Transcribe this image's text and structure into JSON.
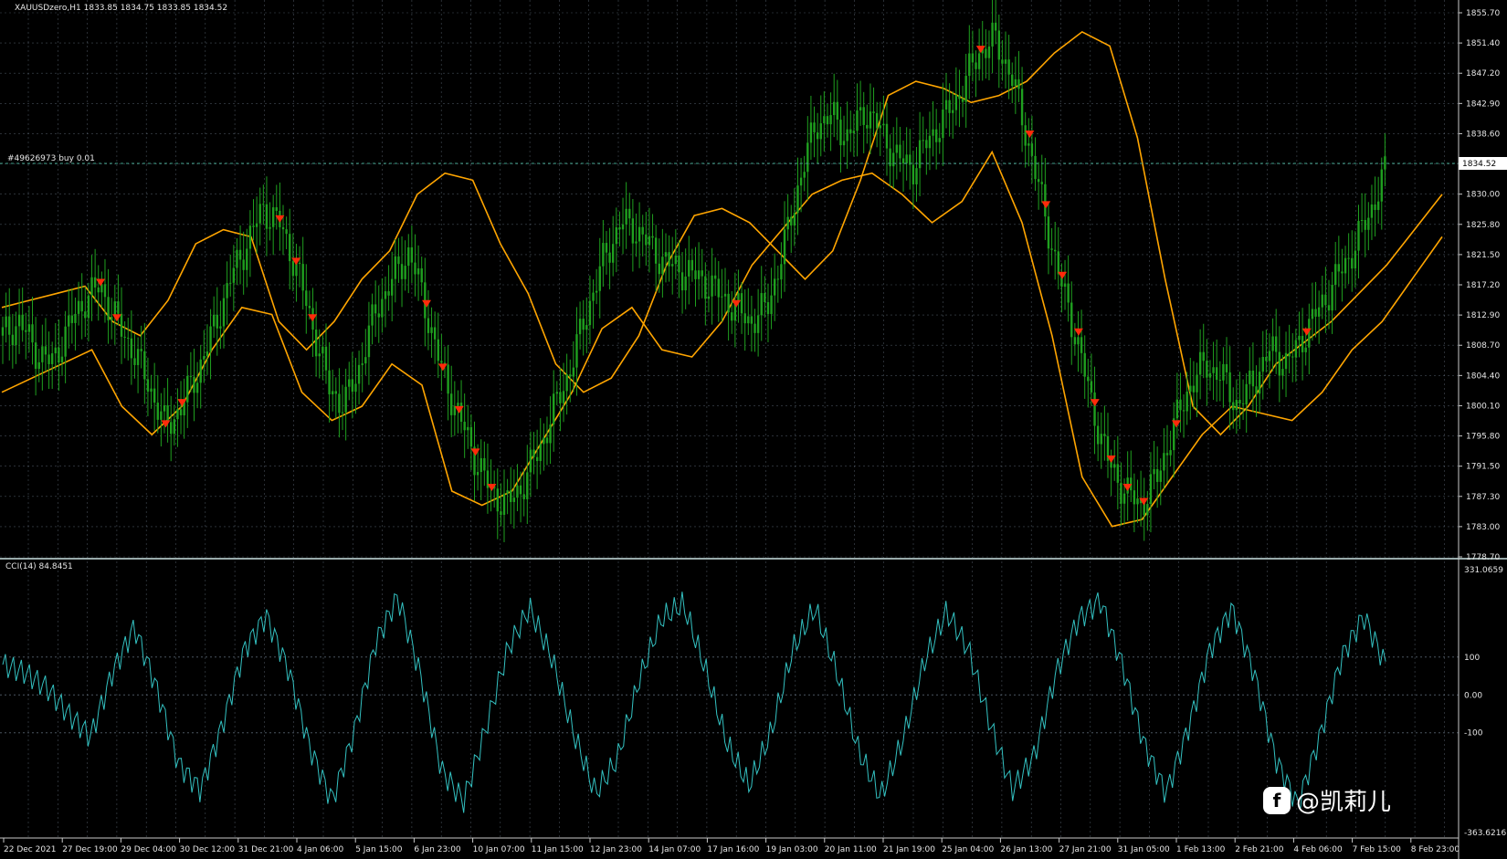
{
  "header": {
    "title": "XAUUSDzero,H1  1833.85 1834.75 1833.85 1834.52"
  },
  "order_line": {
    "label": "#49626973 buy 0.01",
    "price_tag": "1834.52"
  },
  "price_axis": [
    "1855.70",
    "1851.40",
    "1847.20",
    "1842.90",
    "1838.60",
    "1834.52",
    "1830.00",
    "1825.80",
    "1821.50",
    "1817.20",
    "1812.90",
    "1808.70",
    "1804.40",
    "1800.10",
    "1795.80",
    "1791.50",
    "1787.30",
    "1783.00",
    "1778.70"
  ],
  "cci": {
    "label": "CCI(14) 84.8451",
    "axis": [
      "331.0659",
      "100",
      "0.00",
      "-100",
      "-363.6216"
    ]
  },
  "time_axis": [
    "22 Dec 2021",
    "27 Dec 19:00",
    "29 Dec 04:00",
    "30 Dec 12:00",
    "31 Dec 21:00",
    "4 Jan 06:00",
    "5 Jan 15:00",
    "6 Jan 23:00",
    "10 Jan 07:00",
    "11 Jan 15:00",
    "12 Jan 23:00",
    "14 Jan 07:00",
    "17 Jan 16:00",
    "19 Jan 03:00",
    "20 Jan 11:00",
    "21 Jan 19:00",
    "25 Jan 04:00",
    "26 Jan 13:00",
    "27 Jan 21:00",
    "31 Jan 05:00",
    "1 Feb 13:00",
    "2 Feb 21:00",
    "4 Feb 06:00",
    "7 Feb 15:00",
    "8 Feb 23:00"
  ],
  "watermark": {
    "icon": "facebook-icon",
    "text": "@凯莉儿"
  },
  "colors": {
    "background": "#000000",
    "grid": "#7f8ea0",
    "candle": "#1fa01f",
    "band": "#ffa500",
    "cci": "#33c1c1",
    "arrow": "#ff2a0a"
  },
  "chart_data": [
    {
      "type": "line",
      "title": "XAUUSDzero,H1",
      "ylim": [
        1778.7,
        1855.7
      ],
      "series": [
        {
          "name": "close",
          "values": [
            1810,
            1812,
            1808,
            1806,
            1811,
            1815,
            1817,
            1812,
            1808,
            1803,
            1797,
            1800,
            1805,
            1811,
            1818,
            1823,
            1828,
            1826,
            1820,
            1812,
            1803,
            1800,
            1806,
            1814,
            1818,
            1822,
            1814,
            1805,
            1799,
            1793,
            1788,
            1786,
            1789,
            1794,
            1800,
            1806,
            1814,
            1821,
            1826,
            1825,
            1822,
            1820,
            1819,
            1818,
            1816,
            1814,
            1812,
            1814,
            1822,
            1832,
            1840,
            1841,
            1838,
            1842,
            1839,
            1835,
            1834,
            1838,
            1841,
            1845,
            1850,
            1852,
            1847,
            1838,
            1828,
            1818,
            1810,
            1800,
            1792,
            1788,
            1786,
            1790,
            1797,
            1803,
            1806,
            1804,
            1800,
            1804,
            1808,
            1806,
            1810,
            1814,
            1818,
            1822,
            1827,
            1833
          ]
        },
        {
          "name": "upper band",
          "values": [
            1814,
            1815,
            1816,
            1817,
            1812,
            1810,
            1815,
            1823,
            1825,
            1824,
            1812,
            1808,
            1812,
            1818,
            1822,
            1830,
            1833,
            1832,
            1823,
            1816,
            1806,
            1802,
            1804,
            1810,
            1820,
            1827,
            1828,
            1826,
            1822,
            1818,
            1822,
            1832,
            1844,
            1846,
            1845,
            1843,
            1844,
            1846,
            1850,
            1853,
            1851,
            1838,
            1818,
            1800,
            1796,
            1800,
            1806,
            1809,
            1812,
            1816,
            1820,
            1825,
            1830
          ]
        },
        {
          "name": "lower band",
          "values": [
            1802,
            1804,
            1806,
            1808,
            1800,
            1796,
            1800,
            1808,
            1814,
            1813,
            1802,
            1798,
            1800,
            1806,
            1803,
            1788,
            1786,
            1788,
            1795,
            1802,
            1811,
            1814,
            1808,
            1807,
            1812,
            1820,
            1825,
            1830,
            1832,
            1833,
            1830,
            1826,
            1829,
            1836,
            1826,
            1810,
            1790,
            1783,
            1784,
            1790,
            1796,
            1800,
            1799,
            1798,
            1802,
            1808,
            1812,
            1818,
            1824
          ]
        }
      ]
    },
    {
      "type": "line",
      "title": "CCI(14) 84.8451",
      "ylim": [
        -363.6216,
        331.0659
      ],
      "series": [
        {
          "name": "CCI",
          "values": [
            80,
            60,
            20,
            -50,
            -110,
            60,
            180,
            20,
            -180,
            -250,
            -80,
            120,
            210,
            70,
            -140,
            -280,
            -100,
            140,
            260,
            60,
            -200,
            -280,
            -90,
            120,
            230,
            100,
            -100,
            -260,
            -170,
            40,
            200,
            240,
            70,
            -130,
            -240,
            -100,
            120,
            230,
            60,
            -150,
            -270,
            -120,
            90,
            220,
            120,
            -80,
            -250,
            -160,
            60,
            200,
            250,
            80,
            -130,
            -260,
            -90,
            120,
            230,
            60,
            -170,
            -290,
            -110,
            100,
            210,
            80
          ]
        }
      ]
    }
  ]
}
